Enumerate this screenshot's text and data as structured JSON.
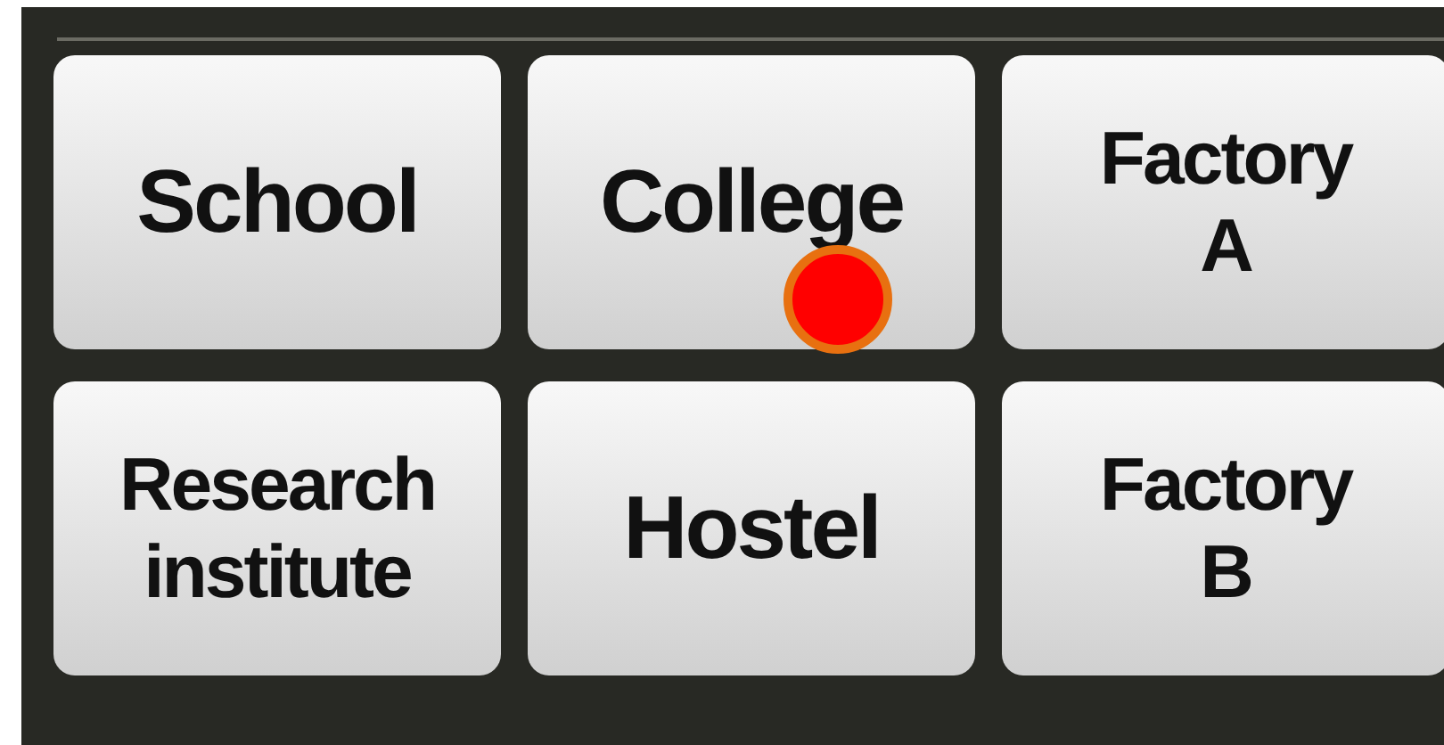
{
  "buttons": [
    {
      "lines": [
        "School"
      ],
      "touched": false
    },
    {
      "lines": [
        "College"
      ],
      "touched": true
    },
    {
      "lines": [
        "Factory",
        "A"
      ],
      "touched": false
    },
    {
      "lines": [
        "Research",
        "institute"
      ],
      "touched": false
    },
    {
      "lines": [
        "Hostel"
      ],
      "touched": false
    },
    {
      "lines": [
        "Factory",
        "B"
      ],
      "touched": false
    }
  ]
}
